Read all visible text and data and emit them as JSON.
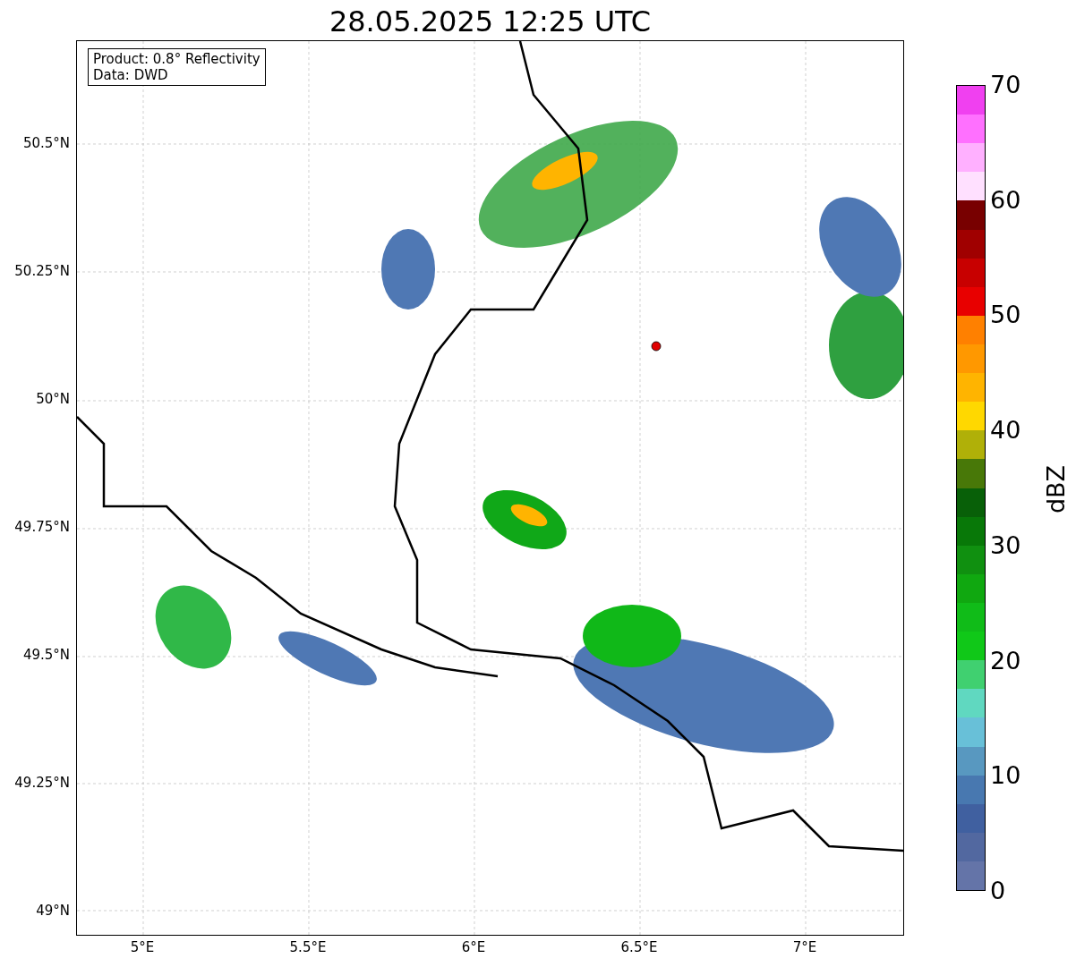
{
  "title": "28.05.2025 12:25 UTC",
  "info_box": [
    "Product: 0.8° Reflectivity",
    "Data: DWD"
  ],
  "y_ticks": [
    "50.5°N",
    "50.25°N",
    "50°N",
    "49.75°N",
    "49.5°N",
    "49.25°N",
    "49°N"
  ],
  "x_ticks": [
    "5°E",
    "5.5°E",
    "6°E",
    "6.5°E",
    "7°E"
  ],
  "colorbar": {
    "label": "dBZ",
    "ticks": [
      "70",
      "60",
      "50",
      "40",
      "30",
      "20",
      "10",
      "0"
    ],
    "bands": [
      {
        "color": "#f040f0"
      },
      {
        "color": "#ff70ff"
      },
      {
        "color": "#ffb0ff"
      },
      {
        "color": "#ffe0ff"
      },
      {
        "color": "#780000"
      },
      {
        "color": "#a00000"
      },
      {
        "color": "#c80000"
      },
      {
        "color": "#e80000"
      },
      {
        "color": "#ff8000"
      },
      {
        "color": "#ff9800"
      },
      {
        "color": "#ffb400"
      },
      {
        "color": "#ffd800"
      },
      {
        "color": "#b0b008"
      },
      {
        "color": "#487808"
      },
      {
        "color": "#086008"
      },
      {
        "color": "#087808"
      },
      {
        "color": "#109010"
      },
      {
        "color": "#10a810"
      },
      {
        "color": "#10bc18"
      },
      {
        "color": "#10c818"
      },
      {
        "color": "#40d070"
      },
      {
        "color": "#60d8c0"
      },
      {
        "color": "#68c0d8"
      },
      {
        "color": "#5898c0"
      },
      {
        "color": "#4878b0"
      },
      {
        "color": "#4060a0"
      },
      {
        "color": "#5268a0"
      },
      {
        "color": "#6474a8"
      }
    ]
  }
}
